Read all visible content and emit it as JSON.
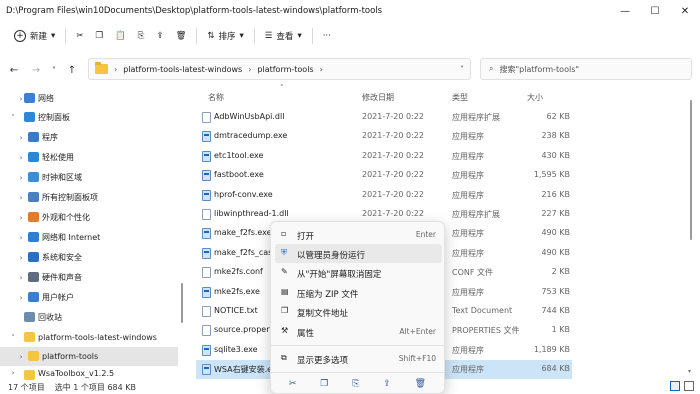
{
  "window": {
    "title": "D:\\Program Files\\win10Documents\\Desktop\\platform-tools-latest-windows\\platform-tools",
    "minimize": "—",
    "maximize": "☐",
    "close": "✕"
  },
  "toolbar": {
    "new_label": "新建",
    "sort_label": "排序",
    "view_label": "查看",
    "more_label": "···"
  },
  "address": {
    "crumb1": "platform-tools-latest-windows",
    "crumb2": "platform-tools",
    "sep": "›",
    "search_placeholder": "搜索\"platform-tools\""
  },
  "sidebar": {
    "items": [
      {
        "label": "网络",
        "color": "#3b7fd6"
      },
      {
        "label": "控制面板",
        "color": "#2f87d8"
      },
      {
        "label": "程序",
        "color": "#3a7bc8"
      },
      {
        "label": "轻松使用",
        "color": "#2a86d6"
      },
      {
        "label": "时钟和区域",
        "color": "#3c8ed4"
      },
      {
        "label": "所有控制面板项",
        "color": "#4a7fc2"
      },
      {
        "label": "外观和个性化",
        "color": "#e27b2c"
      },
      {
        "label": "网络和 Internet",
        "color": "#2d7fd3"
      },
      {
        "label": "系统和安全",
        "color": "#2a6fc0"
      },
      {
        "label": "硬件和声音",
        "color": "#5d6d7e"
      },
      {
        "label": "用户帐户",
        "color": "#3b7dcf"
      },
      {
        "label": "回收站",
        "color": "#6b8cae"
      },
      {
        "label": "platform-tools-latest-windows",
        "color": "#f5c542"
      },
      {
        "label": "platform-tools",
        "color": "#f5c542"
      },
      {
        "label": "WsaToolbox_v1.2.5",
        "color": "#f5c542"
      }
    ]
  },
  "columns": {
    "name": "名称",
    "date": "修改日期",
    "type": "类型",
    "size": "大小"
  },
  "files": [
    {
      "name": "AdbWinUsbApi.dll",
      "date": "2021-7-20 0:22",
      "type": "应用程序扩展",
      "size": "62 KB",
      "kind": "dll"
    },
    {
      "name": "dmtracedump.exe",
      "date": "2021-7-20 0:22",
      "type": "应用程序",
      "size": "238 KB",
      "kind": "exe"
    },
    {
      "name": "etc1tool.exe",
      "date": "2021-7-20 0:22",
      "type": "应用程序",
      "size": "430 KB",
      "kind": "exe"
    },
    {
      "name": "fastboot.exe",
      "date": "2021-7-20 0:22",
      "type": "应用程序",
      "size": "1,595 KB",
      "kind": "exe"
    },
    {
      "name": "hprof-conv.exe",
      "date": "2021-7-20 0:22",
      "type": "应用程序",
      "size": "216 KB",
      "kind": "exe"
    },
    {
      "name": "libwinpthread-1.dll",
      "date": "2021-7-20 0:22",
      "type": "应用程序扩展",
      "size": "227 KB",
      "kind": "dll"
    },
    {
      "name": "make_f2fs.exe",
      "date": "",
      "type": "应用程序",
      "size": "490 KB",
      "kind": "exe"
    },
    {
      "name": "make_f2fs_case",
      "date": "",
      "type": "应用程序",
      "size": "490 KB",
      "kind": "exe"
    },
    {
      "name": "mke2fs.conf",
      "date": "",
      "type": "CONF 文件",
      "size": "2 KB",
      "kind": "doc"
    },
    {
      "name": "mke2fs.exe",
      "date": "",
      "type": "应用程序",
      "size": "753 KB",
      "kind": "exe"
    },
    {
      "name": "NOTICE.txt",
      "date": "",
      "type": "Text Document",
      "size": "744 KB",
      "kind": "doc"
    },
    {
      "name": "source.propert",
      "date": "",
      "type": "PROPERTIES 文件",
      "size": "1 KB",
      "kind": "doc"
    },
    {
      "name": "sqlite3.exe",
      "date": "",
      "type": "应用程序",
      "size": "1,189 KB",
      "kind": "exe"
    },
    {
      "name": "WSA右键安装.ex",
      "date": "",
      "type": "应用程序",
      "size": "684 KB",
      "kind": "exe"
    }
  ],
  "context_menu": {
    "items": [
      {
        "label": "打开",
        "key": "Enter"
      },
      {
        "label": "以管理员身份运行",
        "key": ""
      },
      {
        "label": "从\"开始\"屏幕取消固定",
        "key": ""
      },
      {
        "label": "压缩为 ZIP 文件",
        "key": ""
      },
      {
        "label": "复制文件地址",
        "key": ""
      },
      {
        "label": "属性",
        "key": "Alt+Enter"
      },
      {
        "label": "显示更多选项",
        "key": "Shift+F10"
      }
    ]
  },
  "status": {
    "count": "17 个项目",
    "selected": "选中 1 个项目  684 KB"
  }
}
